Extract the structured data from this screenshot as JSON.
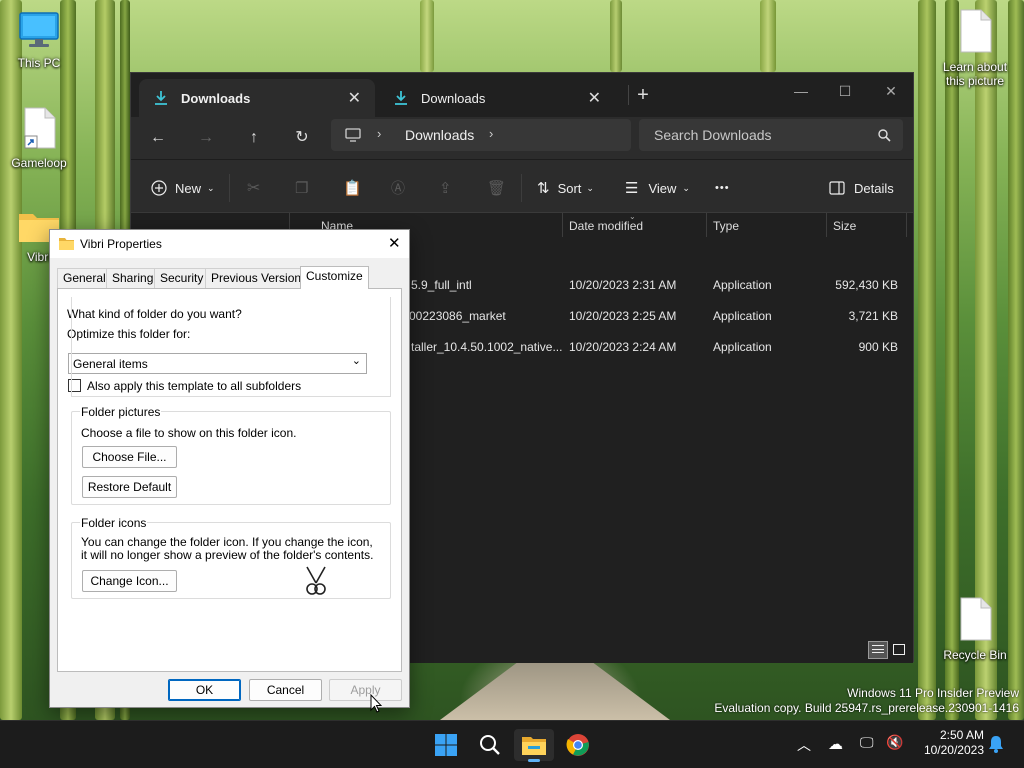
{
  "desktop": {
    "icons": [
      {
        "label": "This PC"
      },
      {
        "label": "Gameloop"
      },
      {
        "label": "Vibri"
      },
      {
        "label": "Learn about this picture"
      },
      {
        "label": "Recycle Bin"
      }
    ],
    "watermark": {
      "line1": "Windows 11 Pro Insider Preview",
      "line2": "Evaluation copy. Build 25947.rs_prerelease.230901-1416"
    }
  },
  "explorer": {
    "tabs": [
      {
        "label": "Downloads",
        "active": true
      },
      {
        "label": "Downloads",
        "active": false
      }
    ],
    "breadcrumb": [
      "Downloads"
    ],
    "search_placeholder": "Search Downloads",
    "commands": {
      "new": "New",
      "sort": "Sort",
      "view": "View",
      "more": "•••",
      "details": "Details"
    },
    "columns": [
      "Name",
      "Date modified",
      "Type",
      "Size"
    ],
    "files": [
      {
        "name": "5.9_full_intl",
        "date": "10/20/2023 2:31 AM",
        "type": "Application",
        "size": "592,430 KB"
      },
      {
        "name": "00223086_market",
        "date": "10/20/2023 2:25 AM",
        "type": "Application",
        "size": "3,721 KB"
      },
      {
        "name": "taller_10.4.50.1002_native...",
        "date": "10/20/2023 2:24 AM",
        "type": "Application",
        "size": "900 KB"
      }
    ]
  },
  "properties": {
    "title": "Vibri Properties",
    "tabs": [
      "General",
      "Sharing",
      "Security",
      "Previous Versions",
      "Customize"
    ],
    "selected_tab": "Customize",
    "folder_kind": {
      "heading": "What kind of folder do you want?",
      "optimize_label": "Optimize this folder for:",
      "selected": "General items",
      "apply_subfolders": "Also apply this template to all subfolders"
    },
    "folder_pictures": {
      "heading": "Folder pictures",
      "description": "Choose a file to show on this folder icon.",
      "choose_button": "Choose File...",
      "restore_button": "Restore Default"
    },
    "folder_icons": {
      "heading": "Folder icons",
      "description": "You can change the folder icon. If you change the icon, it will no longer show a preview of the folder's contents.",
      "change_button": "Change Icon..."
    },
    "buttons": {
      "ok": "OK",
      "cancel": "Cancel",
      "apply": "Apply"
    }
  },
  "taskbar": {
    "time": "2:50 AM",
    "date": "10/20/2023"
  }
}
